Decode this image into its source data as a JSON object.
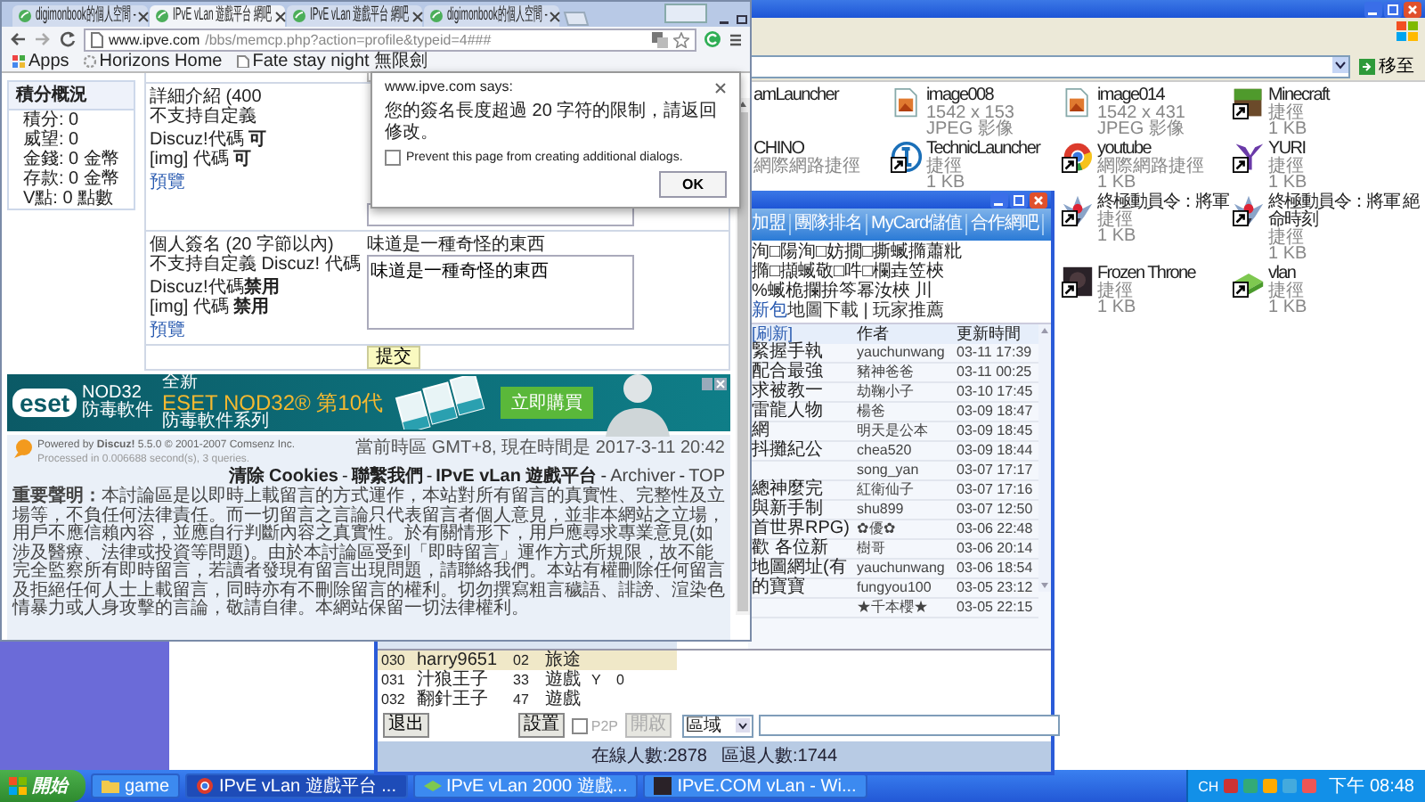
{
  "explorer": {
    "go_button": "移至",
    "icon_rows": [
      [
        {
          "kind": "none",
          "name": "amLauncher"
        },
        {
          "kind": "image",
          "name": "image008",
          "lines": [
            "1542 x 153",
            "JPEG 影像"
          ],
          "shortcut": false
        },
        {
          "kind": "image",
          "name": "image014",
          "lines": [
            "1542 x 431",
            "JPEG 影像"
          ],
          "shortcut": false
        },
        {
          "kind": "grass",
          "name": "Minecraft",
          "lines": [
            "捷徑",
            "1 KB"
          ],
          "shortcut": true
        }
      ],
      [
        {
          "kind": "none",
          "name": "CHINO",
          "lines": [
            "網際網路捷徑"
          ]
        },
        {
          "kind": "technic",
          "name": "TechnicLauncher",
          "lines": [
            "捷徑",
            "1 KB"
          ],
          "shortcut": true
        },
        {
          "kind": "browser",
          "name": "youtube",
          "lines": [
            "網際網路捷徑",
            "1 KB"
          ],
          "shortcut": true
        },
        {
          "kind": "yuri",
          "name": "YURI",
          "lines": [
            "捷徑",
            "1 KB"
          ],
          "shortcut": true
        }
      ],
      [
        {
          "kind": "emblem",
          "name": "終極動員令：將軍",
          "lines": [
            "捷徑",
            "1 KB"
          ],
          "shortcut": true
        },
        {
          "kind": "emblem",
          "name": "終極動員令：將軍 絕命時刻",
          "lines": [
            "捷徑",
            "1 KB"
          ],
          "shortcut": true
        }
      ],
      [
        {
          "kind": "dark",
          "name": "Frozen Throne",
          "lines": [
            "捷徑",
            "1 KB"
          ],
          "shortcut": true
        },
        {
          "kind": "vlan",
          "name": "vlan",
          "lines": [
            "捷徑",
            "1 KB"
          ],
          "shortcut": true
        }
      ]
    ]
  },
  "lobby": {
    "nav": [
      "加盟",
      "團隊排名",
      "MyCard儲值",
      "合作網吧"
    ],
    "marquee": [
      "洵□陽洵□妨撊□撕蝛撱蕭粃",
      "撱□擷蝛敬□吽□欄垚笠梜",
      "%蝛桅攔拚笒幂汝梜 川"
    ],
    "links": [
      {
        "text": "新包",
        "kind": "link"
      },
      {
        "text": "地圖下載 | 玩家推薦",
        "kind": "plain"
      }
    ],
    "columns": [
      "[刷新]",
      "作者",
      "更新時間"
    ],
    "topics": [
      {
        "title": "緊握手執",
        "author": "yauchunwang",
        "time": "03-11 17:39"
      },
      {
        "title": "配合最強",
        "author": "豬神爸爸",
        "time": "03-11 00:25"
      },
      {
        "title": "求被教一",
        "author": "劫鞠小子",
        "time": "03-10 17:45"
      },
      {
        "title": "雷龍人物",
        "author": "楊爸",
        "time": "03-09 18:47"
      },
      {
        "title": "網",
        "author": "明天是公本",
        "time": "03-09 18:45"
      },
      {
        "title": "抖攤紀公",
        "author": "chea520",
        "time": "03-09 18:44"
      },
      {
        "author": "song_yan",
        "time": "03-07 17:17"
      },
      {
        "title": "總神麼完",
        "author": "紅衛仙子",
        "time": "03-07 17:16"
      },
      {
        "title": "與新手制",
        "author": "shu899",
        "time": "03-07 12:50"
      },
      {
        "title": "首世界RPG)",
        "author": "✿優✿",
        "time": "03-06 22:48"
      },
      {
        "title": "歡 各位新",
        "author": "樹哥",
        "time": "03-06 20:14"
      },
      {
        "title": "地圖網址(有",
        "author": "yauchunwang",
        "time": "03-06 18:54"
      },
      {
        "title": "的寶寶",
        "author": "fungyou100",
        "time": "03-05 23:12"
      },
      {
        "author": "★千本櫻★",
        "time": "03-05 22:15"
      }
    ],
    "users": [
      {
        "no": "030",
        "name": "harry9651",
        "rank": "02",
        "status": "旅途",
        "selected": true
      },
      {
        "no": "031",
        "name": "汁狼王子",
        "rank": "33",
        "status": "遊戲",
        "flag": "Y",
        "count": "0",
        "selected": false
      },
      {
        "no": "032",
        "name": "翻針王子",
        "rank": "47",
        "status": "遊戲",
        "selected": false
      }
    ],
    "exit_button": "退出",
    "settings_button": "設置",
    "p2p": {
      "label": "P2P",
      "checked": false,
      "disabled": true
    },
    "open_button": {
      "label": "開啟",
      "disabled": true
    },
    "region": "區域",
    "status": [
      "在線人數:2878",
      "區退人數:1744"
    ]
  },
  "browser": {
    "tabs": [
      {
        "title": "digimonbook的個人空間 -",
        "selected": false
      },
      {
        "title": "IPvE vLan 遊戲平台 網吧",
        "selected": true
      },
      {
        "title": "IPvE vLan 遊戲平台 網吧",
        "selected": false
      },
      {
        "title": "digimonbook的個人空間 -",
        "selected": false
      }
    ],
    "url_host": "www.ipve.com",
    "url_path": "/bbs/memcp.php?action=profile&typeid=4###",
    "bookmarks": [
      {
        "kind": "apps",
        "label": "Apps"
      },
      {
        "kind": "globe",
        "label": "Horizons Home"
      },
      {
        "kind": "page",
        "label": "Fate stay night 無限劍"
      }
    ],
    "sidebar": {
      "title": "積分概況",
      "items": [
        "積分: 0",
        "威望: 0",
        "金錢: 0 金幣",
        "存款: 0 金幣",
        "V點: 0 點數"
      ]
    },
    "form": {
      "rows": [
        {
          "labels": [
            "詳細介紹 (400",
            "不支持自定義"
          ],
          "codes": [
            "Discuz!代碼 **可**",
            "[img] 代碼 **可**"
          ],
          "preview": "預覽"
        },
        {
          "labels": [
            "個人簽名 (20 字節以內)",
            "不支持自定義 Discuz! 代碼"
          ],
          "codes": [
            "Discuz!代碼**禁用**",
            "[img] 代碼 **禁用**"
          ],
          "preview": "預覽",
          "current": "味道是一種奇怪的東西",
          "value": "味道是一種奇怪的東西"
        }
      ],
      "submit": "提交"
    },
    "ad": {
      "logo": "eset",
      "logo_sub": [
        "NOD32",
        "防毒軟件"
      ],
      "kicker": "全新",
      "headline": "ESET NOD32® 第10代",
      "subline": "防毒軟件系列",
      "cta": "立即購買"
    },
    "footer": {
      "powered": "Powered by **Discuz!** 5.5.0 © 2001-2007 Comsenz Inc.",
      "processed": "Processed in 0.006688 second(s), 3 queries.",
      "time": "當前時區 GMT+8, 現在時間是 2017-3-11 20:42",
      "links": [
        {
          "text": "清除 Cookies",
          "bold": true
        },
        {
          "text": "聯繫我們",
          "bold": true
        },
        {
          "text": "IPvE vLan 遊戲平台",
          "bold": true
        },
        {
          "text": "Archiver",
          "bold": false
        },
        {
          "text": "TOP",
          "bold": false
        }
      ],
      "separator": "-",
      "disclaimer": "**重要聲明：**本討論區是以即時上載留言的方式運作，本站對所有留言的真實性、完整性及立場等，不負任何法律責任。而一切留言之言論只代表留言者個人意見，並非本網站之立場，用戶不應信賴內容，並應自行判斷內容之真實性。於有關情形下，用戶應尋求專業意見(如涉及醫療、法律或投資等問題)。由於本討論區受到「即時留言」運作方式所規限，故不能完全監察所有即時留言，若讀者發現有留言出現問題，請聯絡我們。本站有權刪除任何留言及拒絕任何人士上載留言，同時亦有不刪除留言的權利。切勿撰寫粗言穢語、誹謗、渲染色情暴力或人身攻擊的言論，敬請自律。本網站保留一切法律權利。"
    }
  },
  "dialog": {
    "title": "www.ipve.com says:",
    "message": "您的簽名長度超過 20 字符的限制，請返回修改。",
    "suppress_label": "Prevent this page from creating additional dialogs.",
    "suppress_checked": false,
    "ok": "OK"
  },
  "taskbar": {
    "start": "開始",
    "tasks": [
      {
        "kind": "folder",
        "label": "game",
        "selected": false
      },
      {
        "kind": "chrome",
        "label": "IPvE vLan 遊戲平台 ...",
        "selected": true
      },
      {
        "kind": "vlan",
        "label": "IPvE vLan 2000 遊戲...",
        "selected": false
      },
      {
        "kind": "dark",
        "label": "IPvE.COM vLan - Wi...",
        "selected": false
      }
    ],
    "language": "CH",
    "clock": "下午 08:48"
  }
}
